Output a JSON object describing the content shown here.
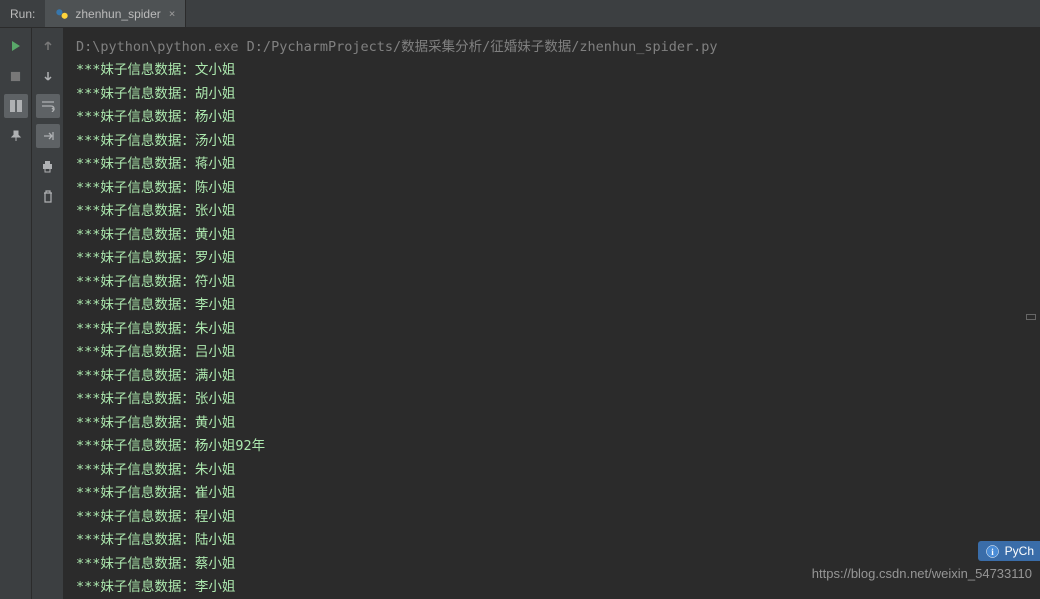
{
  "header": {
    "run_label": "Run:",
    "tab": {
      "label": "zhenhun_spider",
      "close": "×"
    }
  },
  "console": {
    "command": "D:\\python\\python.exe D:/PycharmProjects/数据采集分析/征婚妹子数据/zhenhun_spider.py",
    "lines": [
      "***妹子信息数据：文小姐",
      "***妹子信息数据：胡小姐",
      "***妹子信息数据：杨小姐",
      "***妹子信息数据：汤小姐",
      "***妹子信息数据：蒋小姐",
      "***妹子信息数据：陈小姐",
      "***妹子信息数据：张小姐",
      "***妹子信息数据：黄小姐",
      "***妹子信息数据：罗小姐",
      "***妹子信息数据：符小姐",
      "***妹子信息数据：李小姐",
      "***妹子信息数据：朱小姐",
      "***妹子信息数据：吕小姐",
      "***妹子信息数据：满小姐",
      "***妹子信息数据：张小姐",
      "***妹子信息数据：黄小姐",
      "***妹子信息数据：杨小姐92年",
      "***妹子信息数据：朱小姐",
      "***妹子信息数据：崔小姐",
      "***妹子信息数据：程小姐",
      "***妹子信息数据：陆小姐",
      "***妹子信息数据：蔡小姐",
      "***妹子信息数据：李小姐"
    ]
  },
  "watermark": "https://blog.csdn.net/weixin_54733110",
  "badge": "PyCh",
  "icons": {
    "play": "play-icon",
    "stop": "stop-icon",
    "layout": "layout-icon",
    "pin": "pin-icon",
    "arrow_up": "arrow-up-icon",
    "arrow_down": "arrow-down-icon",
    "wrap": "wrap-icon",
    "scroll_end": "scroll-end-icon",
    "print": "print-icon",
    "delete": "delete-icon"
  }
}
